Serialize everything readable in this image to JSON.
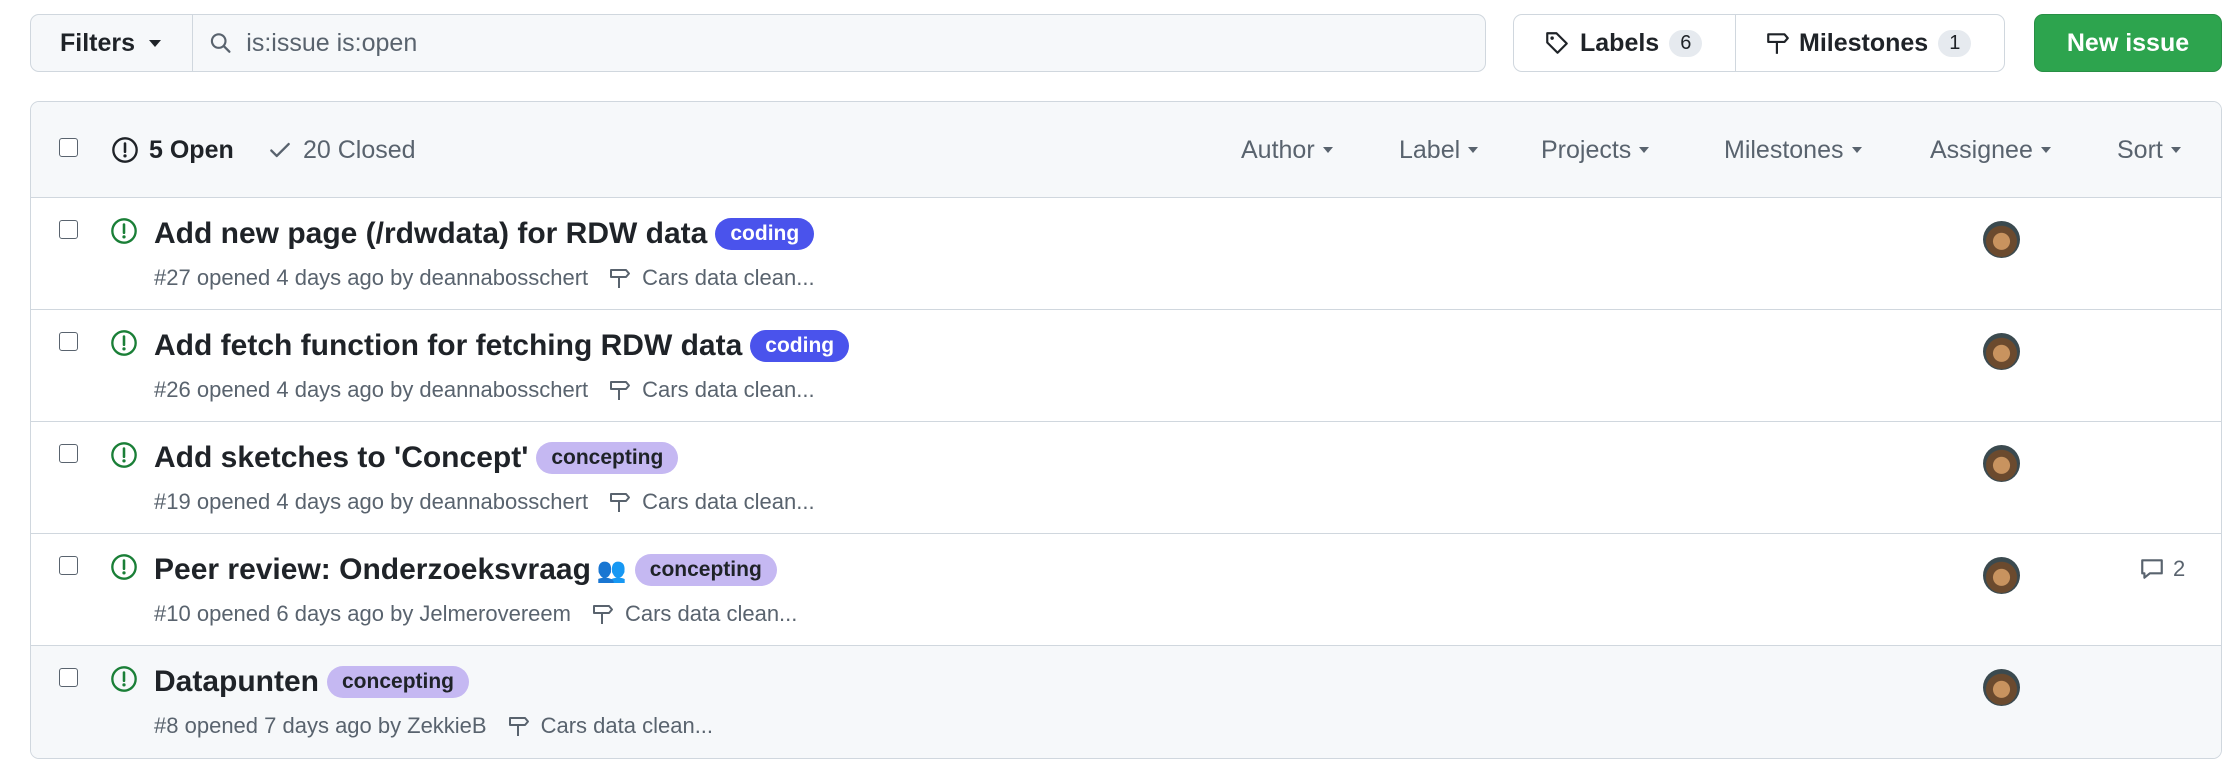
{
  "toolbar": {
    "filters_label": "Filters",
    "search_value": "is:issue is:open",
    "labels_label": "Labels",
    "labels_count": "6",
    "milestones_label": "Milestones",
    "milestones_count": "1",
    "new_issue_label": "New issue"
  },
  "header": {
    "open_label": "5 Open",
    "closed_label": "20 Closed",
    "filters": [
      "Author",
      "Label",
      "Projects",
      "Milestones",
      "Assignee",
      "Sort"
    ]
  },
  "issues": [
    {
      "title": "Add new page (/rdwdata) for RDW data",
      "emoji": "",
      "label": "coding",
      "number": "#27",
      "opened": "opened 4 days ago by",
      "author": "deannabosschert",
      "milestone": "Cars data clean...",
      "comments": ""
    },
    {
      "title": "Add fetch function for fetching RDW data",
      "emoji": "",
      "label": "coding",
      "number": "#26",
      "opened": "opened 4 days ago by",
      "author": "deannabosschert",
      "milestone": "Cars data clean...",
      "comments": ""
    },
    {
      "title": "Add sketches to 'Concept'",
      "emoji": "",
      "label": "concepting",
      "number": "#19",
      "opened": "opened 4 days ago by",
      "author": "deannabosschert",
      "milestone": "Cars data clean...",
      "comments": ""
    },
    {
      "title": "Peer review: Onderzoeksvraag",
      "emoji": "👥",
      "label": "concepting",
      "number": "#10",
      "opened": "opened 6 days ago by",
      "author": "Jelmerovereem",
      "milestone": "Cars data clean...",
      "comments": "2"
    },
    {
      "title": "Datapunten",
      "emoji": "",
      "label": "concepting",
      "number": "#8",
      "opened": "opened 7 days ago by",
      "author": "ZekkieB",
      "milestone": "Cars data clean...",
      "comments": ""
    }
  ],
  "colors": {
    "open_green": "#1a7f37",
    "new_issue_green": "#2da44e",
    "label_coding": "#4a53ec",
    "label_concepting": "#c5b8f2"
  }
}
